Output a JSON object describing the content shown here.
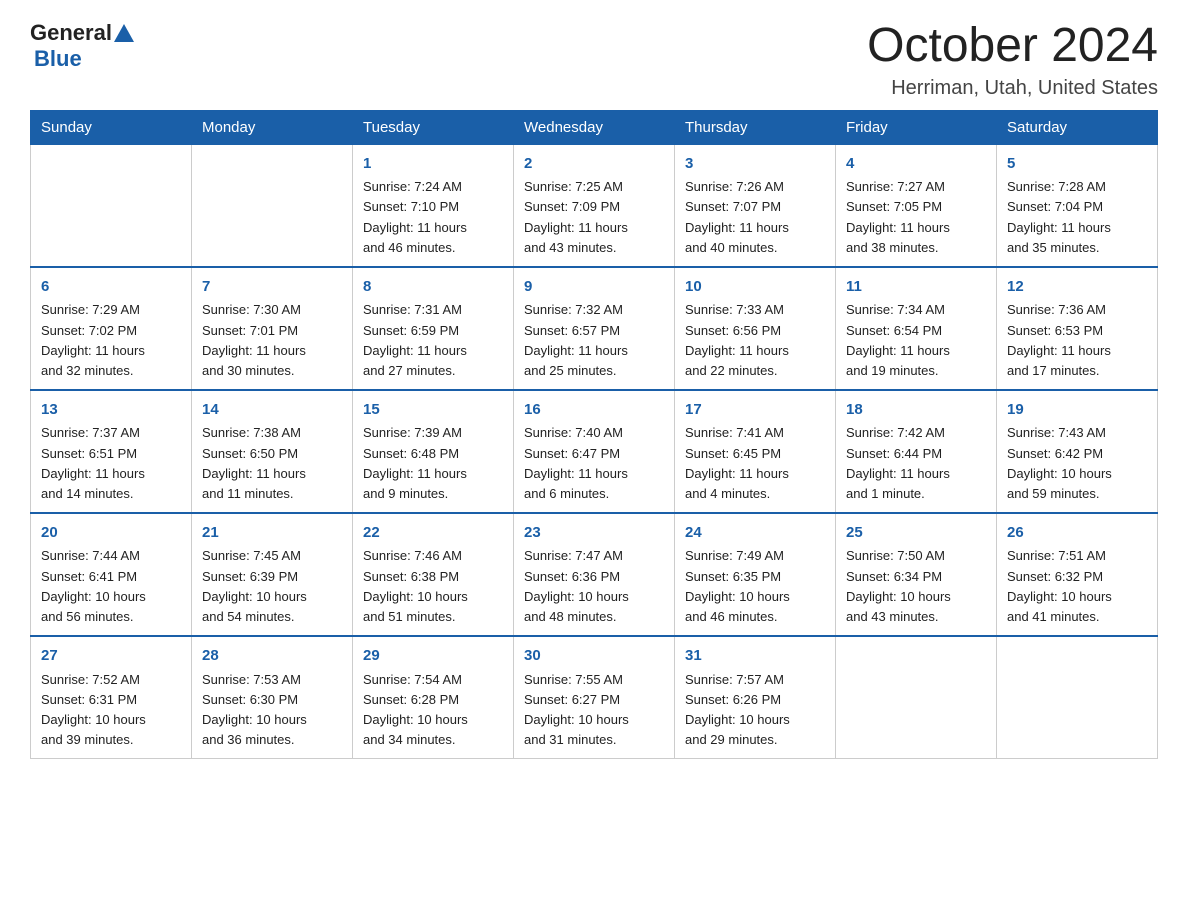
{
  "header": {
    "logo_general": "General",
    "logo_blue": "Blue",
    "month_title": "October 2024",
    "location": "Herriman, Utah, United States"
  },
  "weekdays": [
    "Sunday",
    "Monday",
    "Tuesday",
    "Wednesday",
    "Thursday",
    "Friday",
    "Saturday"
  ],
  "weeks": [
    [
      {
        "day": "",
        "info": ""
      },
      {
        "day": "",
        "info": ""
      },
      {
        "day": "1",
        "info": "Sunrise: 7:24 AM\nSunset: 7:10 PM\nDaylight: 11 hours\nand 46 minutes."
      },
      {
        "day": "2",
        "info": "Sunrise: 7:25 AM\nSunset: 7:09 PM\nDaylight: 11 hours\nand 43 minutes."
      },
      {
        "day": "3",
        "info": "Sunrise: 7:26 AM\nSunset: 7:07 PM\nDaylight: 11 hours\nand 40 minutes."
      },
      {
        "day": "4",
        "info": "Sunrise: 7:27 AM\nSunset: 7:05 PM\nDaylight: 11 hours\nand 38 minutes."
      },
      {
        "day": "5",
        "info": "Sunrise: 7:28 AM\nSunset: 7:04 PM\nDaylight: 11 hours\nand 35 minutes."
      }
    ],
    [
      {
        "day": "6",
        "info": "Sunrise: 7:29 AM\nSunset: 7:02 PM\nDaylight: 11 hours\nand 32 minutes."
      },
      {
        "day": "7",
        "info": "Sunrise: 7:30 AM\nSunset: 7:01 PM\nDaylight: 11 hours\nand 30 minutes."
      },
      {
        "day": "8",
        "info": "Sunrise: 7:31 AM\nSunset: 6:59 PM\nDaylight: 11 hours\nand 27 minutes."
      },
      {
        "day": "9",
        "info": "Sunrise: 7:32 AM\nSunset: 6:57 PM\nDaylight: 11 hours\nand 25 minutes."
      },
      {
        "day": "10",
        "info": "Sunrise: 7:33 AM\nSunset: 6:56 PM\nDaylight: 11 hours\nand 22 minutes."
      },
      {
        "day": "11",
        "info": "Sunrise: 7:34 AM\nSunset: 6:54 PM\nDaylight: 11 hours\nand 19 minutes."
      },
      {
        "day": "12",
        "info": "Sunrise: 7:36 AM\nSunset: 6:53 PM\nDaylight: 11 hours\nand 17 minutes."
      }
    ],
    [
      {
        "day": "13",
        "info": "Sunrise: 7:37 AM\nSunset: 6:51 PM\nDaylight: 11 hours\nand 14 minutes."
      },
      {
        "day": "14",
        "info": "Sunrise: 7:38 AM\nSunset: 6:50 PM\nDaylight: 11 hours\nand 11 minutes."
      },
      {
        "day": "15",
        "info": "Sunrise: 7:39 AM\nSunset: 6:48 PM\nDaylight: 11 hours\nand 9 minutes."
      },
      {
        "day": "16",
        "info": "Sunrise: 7:40 AM\nSunset: 6:47 PM\nDaylight: 11 hours\nand 6 minutes."
      },
      {
        "day": "17",
        "info": "Sunrise: 7:41 AM\nSunset: 6:45 PM\nDaylight: 11 hours\nand 4 minutes."
      },
      {
        "day": "18",
        "info": "Sunrise: 7:42 AM\nSunset: 6:44 PM\nDaylight: 11 hours\nand 1 minute."
      },
      {
        "day": "19",
        "info": "Sunrise: 7:43 AM\nSunset: 6:42 PM\nDaylight: 10 hours\nand 59 minutes."
      }
    ],
    [
      {
        "day": "20",
        "info": "Sunrise: 7:44 AM\nSunset: 6:41 PM\nDaylight: 10 hours\nand 56 minutes."
      },
      {
        "day": "21",
        "info": "Sunrise: 7:45 AM\nSunset: 6:39 PM\nDaylight: 10 hours\nand 54 minutes."
      },
      {
        "day": "22",
        "info": "Sunrise: 7:46 AM\nSunset: 6:38 PM\nDaylight: 10 hours\nand 51 minutes."
      },
      {
        "day": "23",
        "info": "Sunrise: 7:47 AM\nSunset: 6:36 PM\nDaylight: 10 hours\nand 48 minutes."
      },
      {
        "day": "24",
        "info": "Sunrise: 7:49 AM\nSunset: 6:35 PM\nDaylight: 10 hours\nand 46 minutes."
      },
      {
        "day": "25",
        "info": "Sunrise: 7:50 AM\nSunset: 6:34 PM\nDaylight: 10 hours\nand 43 minutes."
      },
      {
        "day": "26",
        "info": "Sunrise: 7:51 AM\nSunset: 6:32 PM\nDaylight: 10 hours\nand 41 minutes."
      }
    ],
    [
      {
        "day": "27",
        "info": "Sunrise: 7:52 AM\nSunset: 6:31 PM\nDaylight: 10 hours\nand 39 minutes."
      },
      {
        "day": "28",
        "info": "Sunrise: 7:53 AM\nSunset: 6:30 PM\nDaylight: 10 hours\nand 36 minutes."
      },
      {
        "day": "29",
        "info": "Sunrise: 7:54 AM\nSunset: 6:28 PM\nDaylight: 10 hours\nand 34 minutes."
      },
      {
        "day": "30",
        "info": "Sunrise: 7:55 AM\nSunset: 6:27 PM\nDaylight: 10 hours\nand 31 minutes."
      },
      {
        "day": "31",
        "info": "Sunrise: 7:57 AM\nSunset: 6:26 PM\nDaylight: 10 hours\nand 29 minutes."
      },
      {
        "day": "",
        "info": ""
      },
      {
        "day": "",
        "info": ""
      }
    ]
  ]
}
